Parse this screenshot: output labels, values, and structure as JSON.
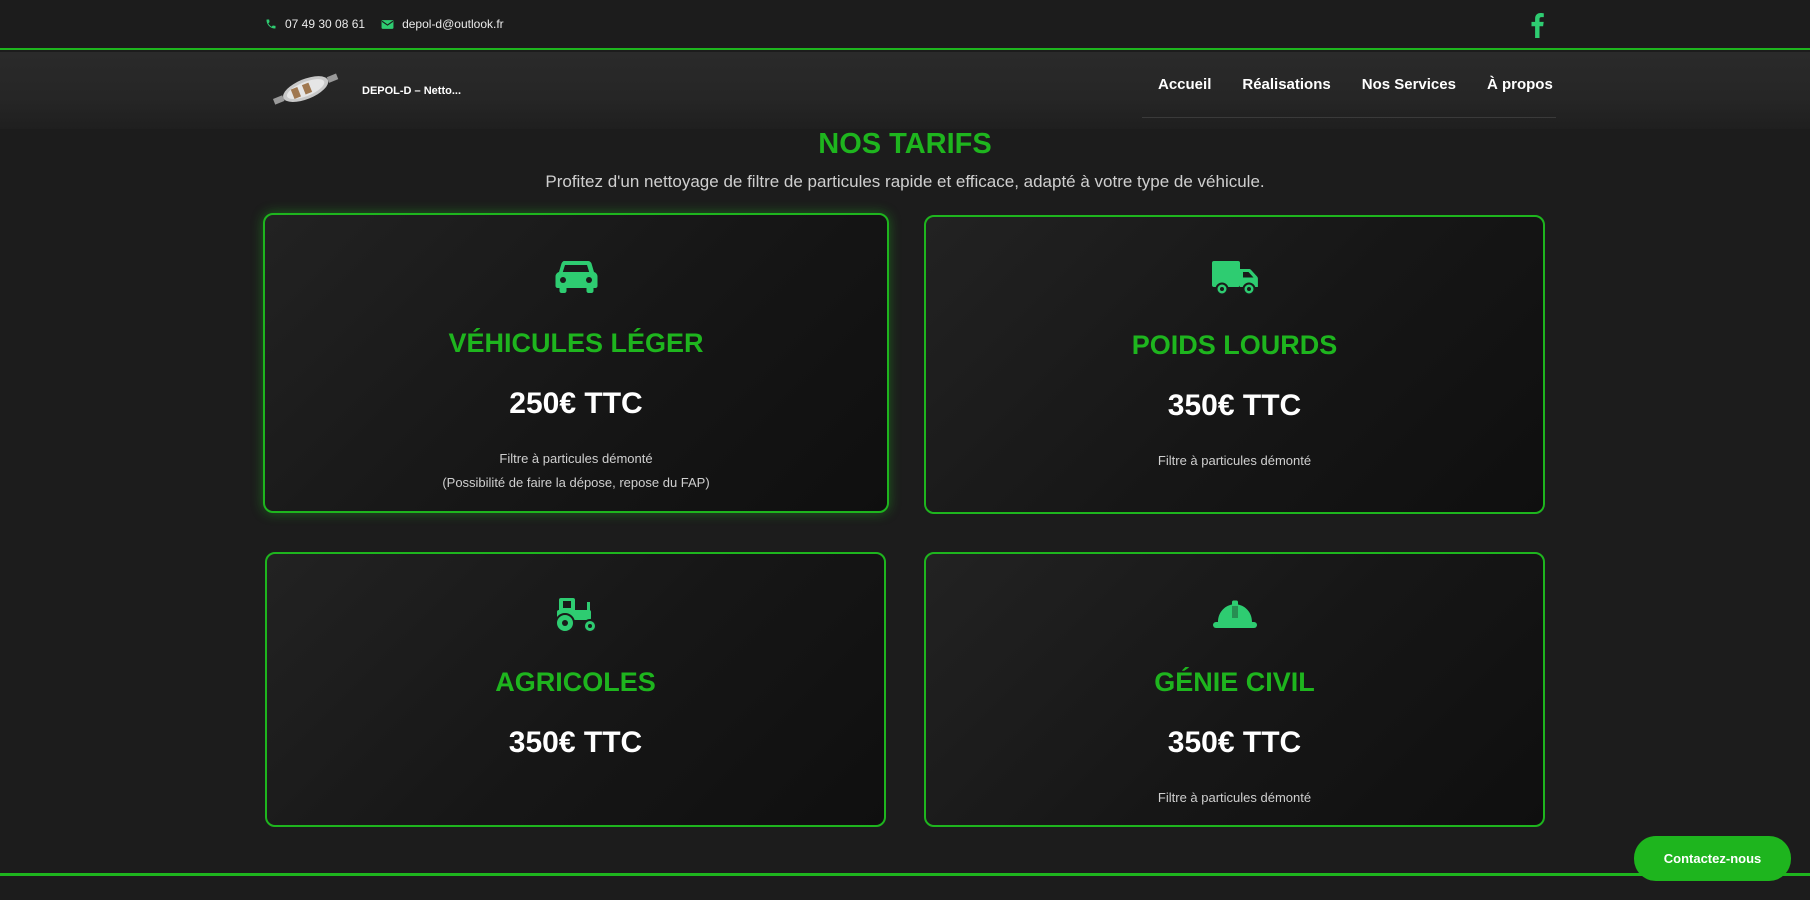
{
  "topbar": {
    "phone": "07 49 30 08 61",
    "email": "depol-d@outlook.fr",
    "social_icon": "facebook-icon"
  },
  "header": {
    "brand": "DEPOL-D – Netto...",
    "nav": [
      "Accueil",
      "Réalisations",
      "Nos Services",
      "À propos"
    ]
  },
  "section": {
    "title": "NOS TARIFS",
    "subtitle": "Profitez d'un nettoyage de filtre de particules rapide et efficace, adapté à votre type de véhicule."
  },
  "cards": [
    {
      "icon": "car-icon",
      "name": "VÉHICULES LÉGER",
      "price": "250€ TTC",
      "desc_line1": "Filtre à particules démonté",
      "desc_line2": "(Possibilité de faire la dépose, repose du FAP)"
    },
    {
      "icon": "truck-icon",
      "name": "POIDS LOURDS",
      "price": "350€ TTC",
      "desc_line1": "Filtre à particules démonté",
      "desc_line2": ""
    },
    {
      "icon": "tractor-icon",
      "name": "AGRICOLES",
      "price": "350€ TTC",
      "desc_line1": "",
      "desc_line2": ""
    },
    {
      "icon": "hard-hat-icon",
      "name": "GÉNIE CIVIL",
      "price": "350€ TTC",
      "desc_line1": "Filtre à particules démonté",
      "desc_line2": ""
    }
  ],
  "cta": {
    "label": "Contactez-nous"
  },
  "colors": {
    "accent": "#1eb51e",
    "icon": "#2ecc71",
    "background": "#1c1c1c"
  }
}
